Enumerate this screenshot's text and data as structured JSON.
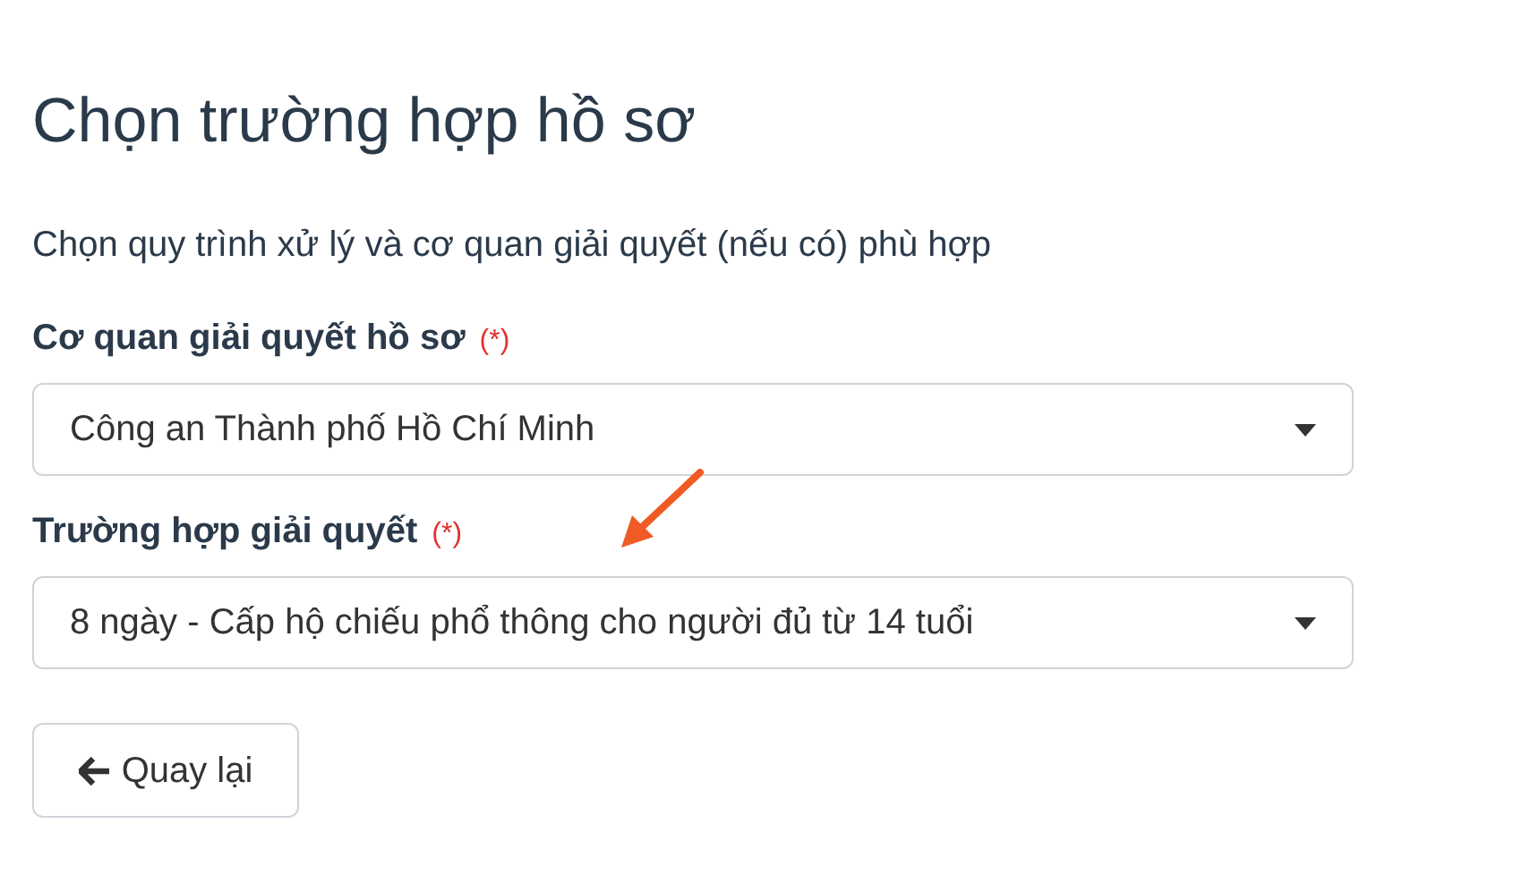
{
  "title": "Chọn trường hợp hồ sơ",
  "subtitle": "Chọn quy trình xử lý và cơ quan giải quyết (nếu có) phù hợp",
  "fields": [
    {
      "label": "Cơ quan giải quyết hồ sơ",
      "required_mark": "(*)",
      "value": "Công an Thành phố Hồ Chí Minh"
    },
    {
      "label": "Trường hợp giải quyết",
      "required_mark": "(*)",
      "value": "8 ngày - Cấp hộ chiếu phổ thông cho người đủ từ 14 tuổi"
    }
  ],
  "back_button": {
    "label": "Quay lại"
  }
}
